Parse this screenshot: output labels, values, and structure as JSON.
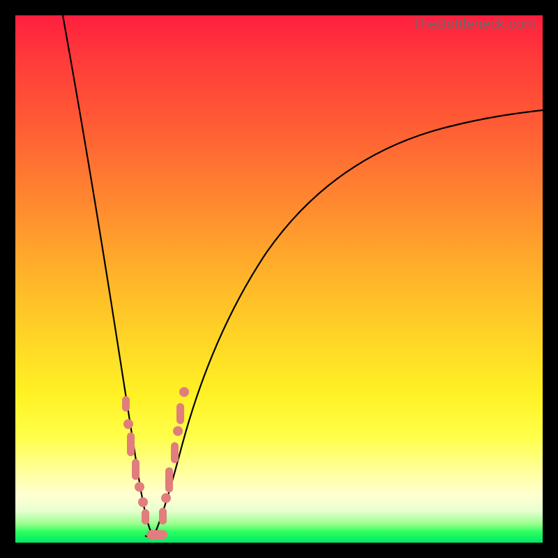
{
  "watermark": "TheBottleneck.com",
  "colors": {
    "marker": "#e17d7d",
    "curve": "#000000",
    "gradient_top": "#ff1f3f",
    "gradient_bottom": "#00e865"
  },
  "chart_data": {
    "type": "line",
    "title": "",
    "xlabel": "",
    "ylabel": "",
    "xlim": [
      0,
      100
    ],
    "ylim": [
      0,
      100
    ],
    "grid": false,
    "legend": false,
    "note": "V-shaped bottleneck curve; minimum (optimal point) near x≈25. Values estimated from pixel positions on a 0–100 normalized scale.",
    "series": [
      {
        "name": "bottleneck-curve-left",
        "x": [
          9,
          12,
          15,
          18,
          20,
          22,
          23,
          24,
          25
        ],
        "values": [
          100,
          85,
          68,
          48,
          30,
          15,
          8,
          3,
          1
        ]
      },
      {
        "name": "bottleneck-curve-right",
        "x": [
          25,
          27,
          29,
          32,
          36,
          42,
          50,
          60,
          72,
          86,
          100
        ],
        "values": [
          1,
          6,
          14,
          24,
          36,
          49,
          60,
          69,
          76,
          80,
          82
        ]
      }
    ],
    "markers": [
      {
        "segment": "left",
        "x": 20.5,
        "y": 27
      },
      {
        "segment": "left",
        "x": 21.2,
        "y": 22
      },
      {
        "segment": "left",
        "x": 21.8,
        "y": 18
      },
      {
        "segment": "left",
        "x": 22.4,
        "y": 14
      },
      {
        "segment": "left",
        "x": 23.0,
        "y": 10
      },
      {
        "segment": "left",
        "x": 23.6,
        "y": 7
      },
      {
        "segment": "left",
        "x": 24.2,
        "y": 4
      },
      {
        "segment": "bottom",
        "x": 25.0,
        "y": 1.5
      },
      {
        "segment": "bottom",
        "x": 26.0,
        "y": 1.5
      },
      {
        "segment": "right",
        "x": 27.0,
        "y": 5
      },
      {
        "segment": "right",
        "x": 27.8,
        "y": 9
      },
      {
        "segment": "right",
        "x": 28.6,
        "y": 13
      },
      {
        "segment": "right",
        "x": 29.4,
        "y": 17
      },
      {
        "segment": "right",
        "x": 30.2,
        "y": 21
      },
      {
        "segment": "right",
        "x": 31.2,
        "y": 26
      },
      {
        "segment": "right",
        "x": 32.2,
        "y": 30
      }
    ]
  }
}
